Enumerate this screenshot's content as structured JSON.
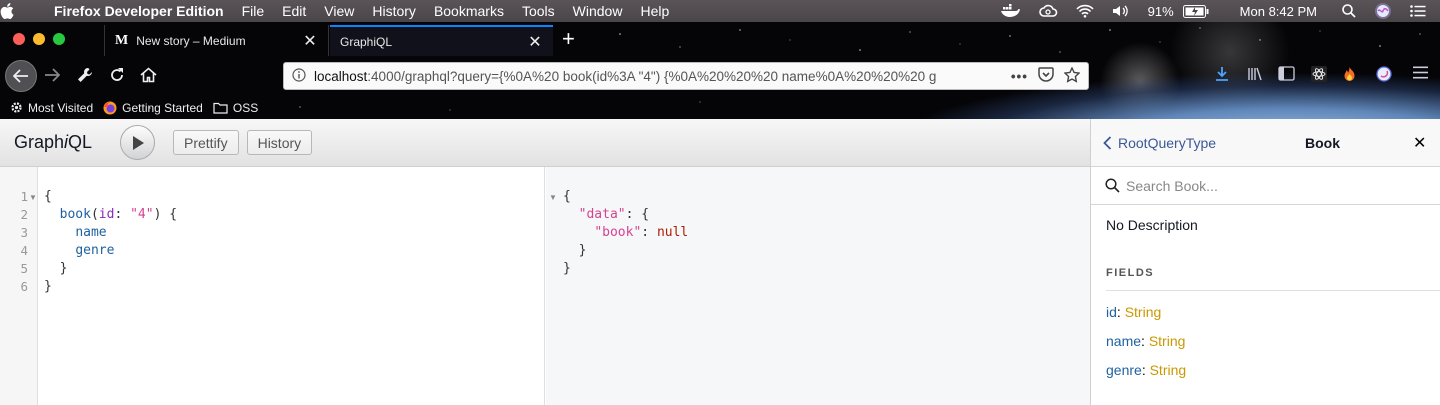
{
  "menubar": {
    "app_name": "Firefox Developer Edition",
    "items": [
      "File",
      "Edit",
      "View",
      "History",
      "Bookmarks",
      "Tools",
      "Window",
      "Help"
    ],
    "battery": "91%",
    "clock": "Mon 8:42 PM"
  },
  "browser": {
    "tabs": [
      {
        "title": "New story – Medium",
        "favicon": "M"
      },
      {
        "title": "GraphiQL",
        "active": true
      }
    ],
    "url_host": "localhost",
    "url_rest": ":4000/graphql?query={%0A%20 book(id%3A \"4\") {%0A%20%20%20 name%0A%20%20%20 g",
    "bookmarks": [
      "Most Visited",
      "Getting Started",
      "OSS"
    ]
  },
  "graphiql": {
    "title_pre": "Graph",
    "title_i": "i",
    "title_post": "QL",
    "prettify_label": "Prettify",
    "history_label": "History",
    "line_numbers": [
      "1",
      "2",
      "3",
      "4",
      "5",
      "6"
    ],
    "query": {
      "open": "{",
      "field": "book",
      "arg_name": "id",
      "arg_value": "\"4\"",
      "sub1": "name",
      "sub2": "genre",
      "close_inner": "}",
      "close_outer": "}"
    },
    "result": {
      "open": "{",
      "key_data": "\"data\"",
      "key_book": "\"book\"",
      "value_book": "null",
      "close_inner": "}",
      "close_outer": "}"
    }
  },
  "docs": {
    "back_label": "RootQueryType",
    "title": "Book",
    "close": "✕",
    "search_placeholder": "Search Book...",
    "description": "No Description",
    "fields_heading": "FIELDS",
    "fields": [
      {
        "name": "id",
        "type": "String"
      },
      {
        "name": "name",
        "type": "String"
      },
      {
        "name": "genre",
        "type": "String"
      }
    ]
  },
  "colors": {
    "accent_tab": "#0a84ff",
    "field_name": "#1f61a0",
    "field_type": "#ca9800",
    "null_value": "#b11a04"
  }
}
